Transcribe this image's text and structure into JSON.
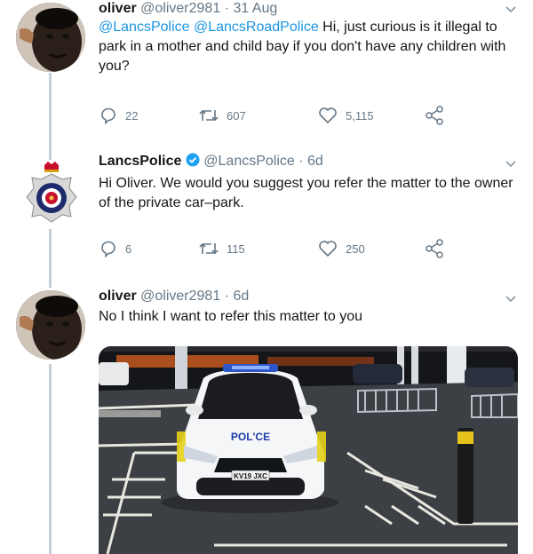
{
  "tweets": [
    {
      "name": "oliver",
      "handle": "@oliver2981",
      "time": "· 31 Aug",
      "mention1": "@LancsPolice",
      "mention2": "@LancsRoadPolice",
      "text": " Hi, just curious is it illegal to park in a mother and child bay if you don't have any children with you?",
      "replies": "22",
      "retweets": "607",
      "likes": "5,115"
    },
    {
      "name": "LancsPolice",
      "handle": "@LancsPolice",
      "time": "· 6d",
      "text": "Hi Oliver. We would you suggest you refer the matter to the owner of the private car–park.",
      "replies": "6",
      "retweets": "115",
      "likes": "250"
    },
    {
      "name": "oliver",
      "handle": "@oliver2981",
      "time": "· 6d",
      "text": "No I think I want to refer this matter to you"
    }
  ],
  "photo": {
    "car_label": "POL'CE",
    "plate": "KV19 JXC"
  },
  "colors": {
    "accent": "#1b95e0",
    "muted": "#657786",
    "verified": "#1da1f2"
  }
}
